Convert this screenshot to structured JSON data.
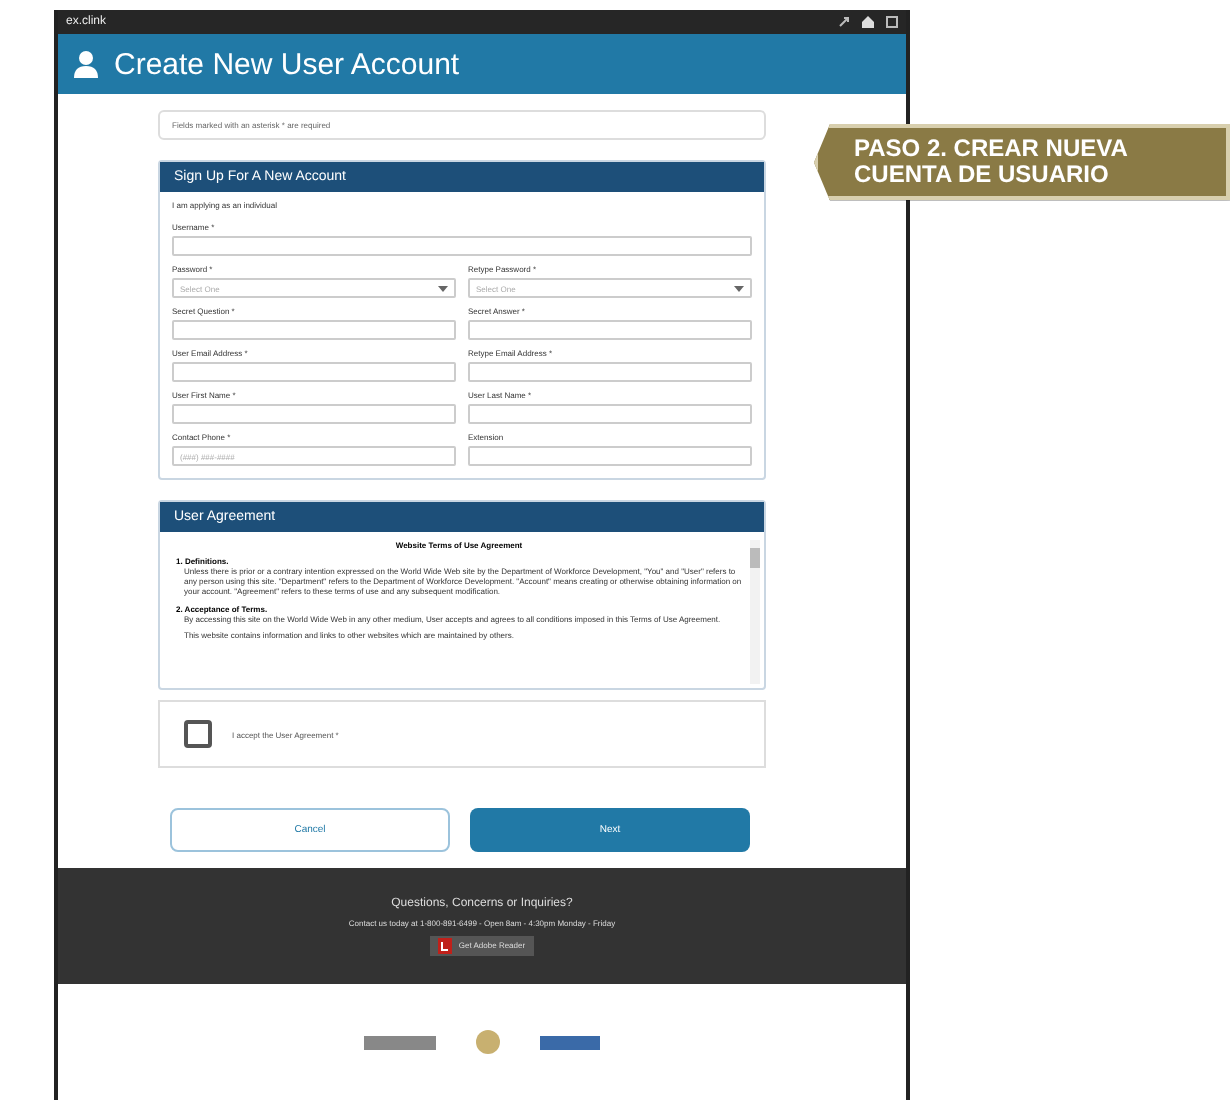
{
  "top_bar": {
    "logo": "ex.clink"
  },
  "header": {
    "title": "Create New User Account"
  },
  "notice": "Fields marked with an asterisk * are required",
  "signup": {
    "title": "Sign Up For A New Account",
    "intro": "I am applying as an individual",
    "fields": [
      {
        "label": "Username *",
        "kind": "wide_input"
      },
      {
        "label": "Password *",
        "kind": "select",
        "placeholder": "Select One"
      },
      {
        "label": "Retype Password *",
        "kind": "select",
        "placeholder": "Select One"
      },
      {
        "label": "Secret Question *",
        "kind": "input"
      },
      {
        "label": "Secret Answer *",
        "kind": "input"
      },
      {
        "label": "User Email Address *",
        "kind": "input"
      },
      {
        "label": "Retype Email Address *",
        "kind": "input"
      },
      {
        "label": "User First Name *",
        "kind": "input"
      },
      {
        "label": "User Last Name *",
        "kind": "input"
      },
      {
        "label": "Contact Phone *",
        "kind": "input",
        "placeholder": "(###) ###-####"
      },
      {
        "label": "Extension",
        "kind": "input"
      }
    ]
  },
  "agreement": {
    "title": "User Agreement",
    "doc_title": "Website Terms of Use Agreement",
    "sections": [
      {
        "heading": "1. Definitions.",
        "body": "Unless there is prior or a contrary intention expressed on the World Wide Web site by the Department of Workforce Development, \"You\" and \"User\" refers to any person using this site. \"Department\" refers to the Department of Workforce Development. \"Account\" means creating or otherwise obtaining information on your account. \"Agreement\" refers to these terms of use and any subsequent modification."
      },
      {
        "heading": "2. Acceptance of Terms.",
        "body": "By accessing this site on the World Wide Web in any other medium, User accepts and agrees to all conditions imposed in this Terms of Use Agreement."
      },
      {
        "body": "This website contains information and links to other websites which are maintained by others."
      }
    ]
  },
  "accept": {
    "label": "I accept the User Agreement *",
    "checked": false
  },
  "buttons": {
    "cancel": "Cancel",
    "next": "Next"
  },
  "footer": {
    "title": "Questions, Concerns or Inquiries?",
    "contact": "Contact us today at 1-800-891-6499 - Open 8am - 4:30pm Monday - Friday",
    "badge": "Get Adobe Reader"
  },
  "banner": {
    "lines": [
      "PASO 2. CREAR NUEVA",
      "CUENTA DE USUARIO"
    ]
  }
}
